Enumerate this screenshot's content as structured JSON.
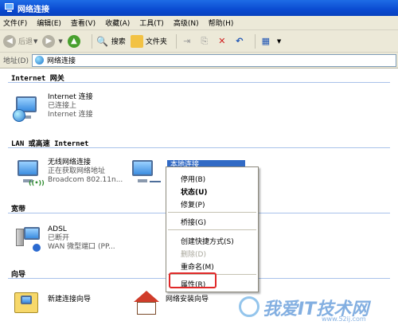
{
  "window": {
    "title": "网络连接"
  },
  "menu": [
    "文件(F)",
    "编辑(E)",
    "查看(V)",
    "收藏(A)",
    "工具(T)",
    "高级(N)",
    "帮助(H)"
  ],
  "toolbar": {
    "back": "后退",
    "search": "搜索",
    "folders": "文件夹"
  },
  "address": {
    "label": "地址(D)",
    "value": "网络连接"
  },
  "groups": {
    "internet_gateway": "Internet 网关",
    "lan": "LAN 或高速 Internet",
    "broadband": "宽带",
    "wizard": "向导"
  },
  "connections": {
    "internet": {
      "name": "Internet 连接",
      "status": "已连接上",
      "device": "Internet 连接"
    },
    "wireless": {
      "name": "无线网络连接",
      "status": "正在获取网络地址",
      "device": "Broadcom 802.11n..."
    },
    "local": {
      "name": "本地连接",
      "status": "已"
    },
    "adsl": {
      "name": "ADSL",
      "status": "已断开",
      "device": "WAN 微型端口 (PP..."
    }
  },
  "wizards": {
    "new_connection": "新建连接向导",
    "network_setup": "网络安装向导"
  },
  "context_menu": {
    "disable": "停用(B)",
    "status": "状态(U)",
    "repair": "修复(P)",
    "bridge": "桥接(G)",
    "shortcut": "创建快捷方式(S)",
    "delete": "删除(D)",
    "rename": "重命名(M)",
    "properties": "属性(R)"
  },
  "watermark": {
    "brand": "我爱IT技术网",
    "url": "www.52ij.com"
  },
  "colors": {
    "titlebar": "#0a4bd1",
    "selection": "#316ac5",
    "highlight": "#e02828"
  }
}
